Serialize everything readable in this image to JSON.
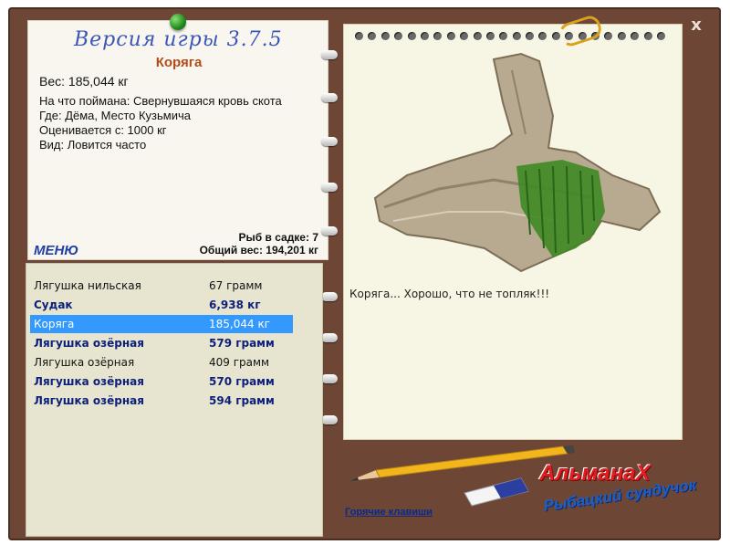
{
  "window": {
    "close_label": "x"
  },
  "header": {
    "version": "Версия игры 3.7.5"
  },
  "catch": {
    "title": "Коряга",
    "weight_label": "Вес: 185,044 кг",
    "details": [
      "На что поймана: Свернувшаяся кровь скота",
      "Где: Дёма, Место Кузьмича",
      "Оценивается с: 1000 кг",
      "Вид: Ловится часто"
    ]
  },
  "summary": {
    "fish_count": "Рыб в садке: 7",
    "total_weight": "Общий вес: 194,201 кг"
  },
  "menu": {
    "label": "МЕНЮ"
  },
  "catch_list": [
    {
      "name": "Лягушка нильская",
      "weight": "67 грамм",
      "bold": false,
      "selected": false
    },
    {
      "name": "Судак",
      "weight": "6,938 кг",
      "bold": true,
      "selected": false
    },
    {
      "name": "Коряга",
      "weight": "185,044 кг",
      "bold": false,
      "selected": true
    },
    {
      "name": "Лягушка озёрная",
      "weight": "579 грамм",
      "bold": true,
      "selected": false
    },
    {
      "name": "Лягушка озёрная",
      "weight": "409 грамм",
      "bold": false,
      "selected": false
    },
    {
      "name": "Лягушка озёрная",
      "weight": "570 грамм",
      "bold": true,
      "selected": false
    },
    {
      "name": "Лягушка озёрная",
      "weight": "594 грамм",
      "bold": true,
      "selected": false
    }
  ],
  "detail_panel": {
    "caption": "Коряга... Хорошо, что не топляк!!!"
  },
  "footer": {
    "hotkeys_label": "Горячие клавиши"
  },
  "logo": {
    "title": "АльманаХ",
    "subtitle": "Рыбацкий сундучок"
  },
  "colors": {
    "frame": "#6d4636",
    "selection": "#3399ff",
    "title": "#b34a1a",
    "version": "#3a57b8"
  }
}
